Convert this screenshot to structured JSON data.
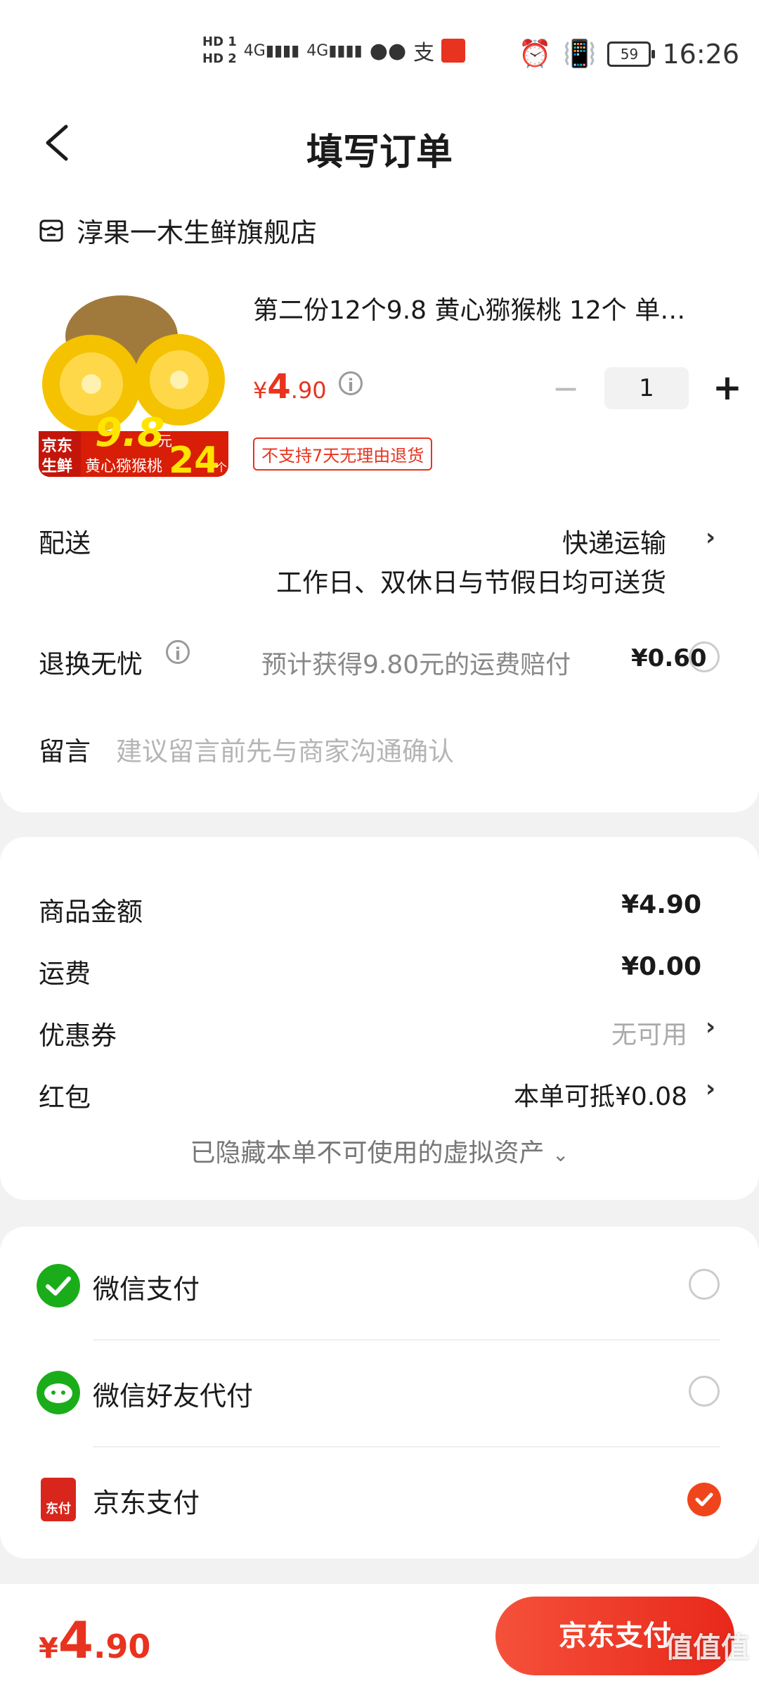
{
  "status_bar": {
    "hd1": "HD 1",
    "hd2": "HD 2",
    "signal1": "4G",
    "signal2": "4G",
    "battery": "59",
    "time": "16:26"
  },
  "nav": {
    "title": "填写订单"
  },
  "shop": {
    "name": "淳果一木生鲜旗舰店"
  },
  "product": {
    "title": "第二份12个9.8 黄心猕猴桃 12个 单…",
    "price_symbol": "¥",
    "price_int": "4",
    "price_dec": ".90",
    "quantity": "1",
    "tag": "不支持7天无理由退货",
    "image_promo": {
      "brand_top": "京东",
      "brand_bottom": "生鲜",
      "price": "9.8",
      "unit": "元",
      "name": "黄心猕猴桃",
      "count": "24",
      "count_unit": "个"
    }
  },
  "delivery": {
    "label": "配送",
    "method": "快递运输",
    "desc": "工作日、双休日与节假日均可送货"
  },
  "return_service": {
    "label": "退换无忧",
    "desc": "预计获得9.80元的运费赔付",
    "price": "¥0.60"
  },
  "message": {
    "label": "留言",
    "placeholder": "建议留言前先与商家沟通确认"
  },
  "amounts": {
    "goods_label": "商品金额",
    "goods_value": "¥4.90",
    "shipping_label": "运费",
    "shipping_value": "¥0.00",
    "coupon_label": "优惠券",
    "coupon_value": "无可用",
    "redpacket_label": "红包",
    "redpacket_value": "本单可抵¥0.08",
    "hidden_assets": "已隐藏本单不可使用的虚拟资产"
  },
  "payment": {
    "methods": [
      {
        "label": "微信支付",
        "selected": false
      },
      {
        "label": "微信好友代付",
        "selected": false
      },
      {
        "label": "京东支付",
        "selected": true
      }
    ],
    "jd_icon_text": "东付"
  },
  "bottom": {
    "total_symbol": "¥",
    "total_int": "4",
    "total_dec": ".90",
    "pay_button": "京东支付",
    "watermark": "值值值"
  },
  "colors": {
    "accent": "#e8331f",
    "wechat_green": "#1aad19"
  }
}
